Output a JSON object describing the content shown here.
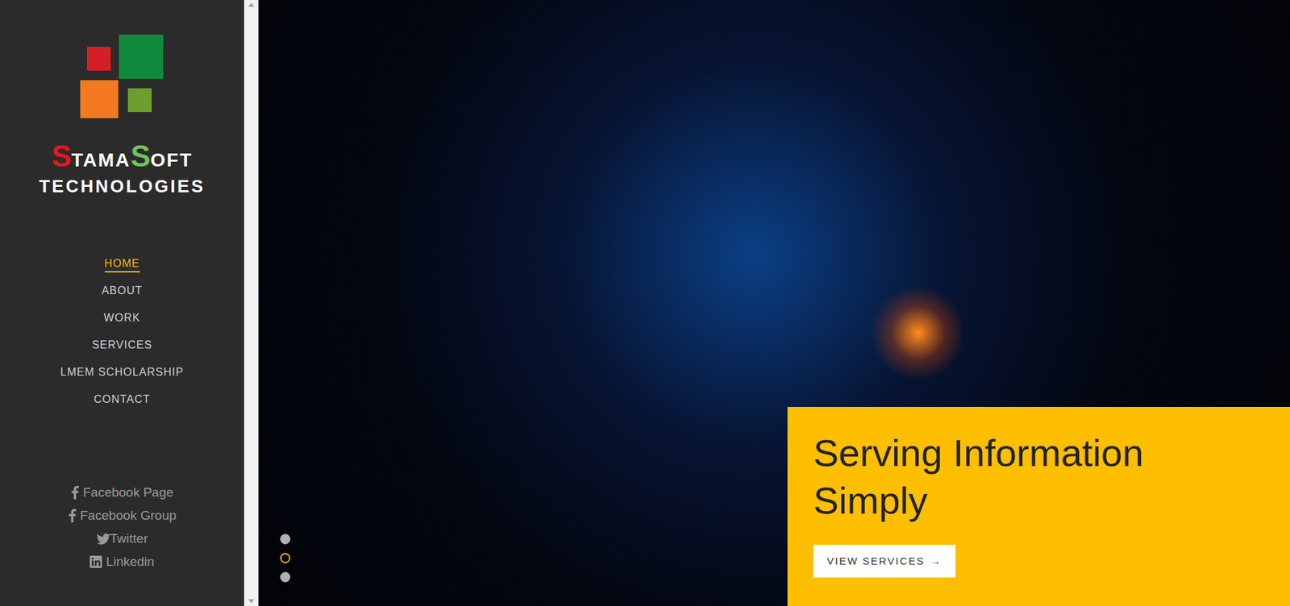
{
  "logo": {
    "brand": [
      {
        "text": "S",
        "kind": "initial",
        "color": "#e8141c"
      },
      {
        "text": "TAMA",
        "kind": "rest",
        "color": "#ffffff"
      },
      {
        "text": "S",
        "kind": "initial",
        "color": "#6fc35b"
      },
      {
        "text": "OFT",
        "kind": "rest",
        "color": "#ffffff"
      }
    ],
    "tagline": "TECHNOLOGIES"
  },
  "nav": [
    {
      "label": "HOME",
      "selected": true
    },
    {
      "label": "ABOUT",
      "selected": false
    },
    {
      "label": "WORK",
      "selected": false
    },
    {
      "label": "SERVICES",
      "selected": false
    },
    {
      "label": "LMEM SCHOLARSHIP",
      "selected": false
    },
    {
      "label": "CONTACT",
      "selected": false
    }
  ],
  "social": [
    {
      "label": "Facebook Page",
      "kind": "facebook"
    },
    {
      "label": "Facebook Group",
      "kind": "facebook"
    },
    {
      "label": "Twitter",
      "kind": "twitter"
    },
    {
      "label": "Linkedin",
      "kind": "linkedin"
    }
  ],
  "hero": {
    "title": "Serving Information Simply",
    "button": {
      "label": "VIEW SERVICES",
      "arrow": "→"
    },
    "slides": [
      {
        "selected": false
      },
      {
        "selected": true
      },
      {
        "selected": false
      }
    ]
  }
}
